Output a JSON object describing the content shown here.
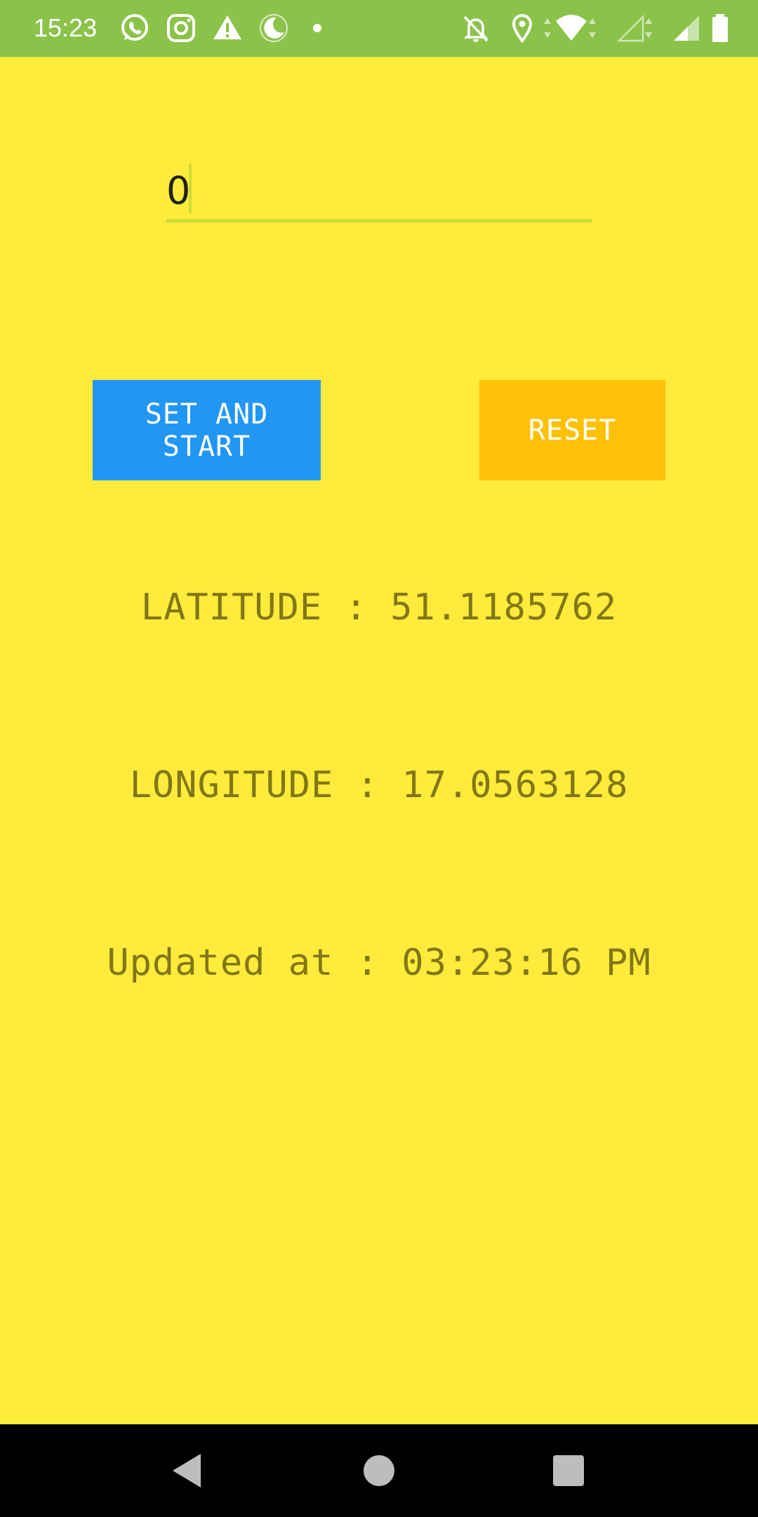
{
  "status_bar": {
    "time": "15:23",
    "background": "#8BC34A",
    "icons": [
      "whatsapp-icon",
      "instagram-icon",
      "warning-icon",
      "night-mode-icon",
      "dot-icon",
      "bell-off-icon",
      "location-icon",
      "wifi-icon",
      "signal-empty-icon",
      "signal-icon",
      "battery-icon"
    ]
  },
  "app": {
    "background": "#FFEB3B",
    "input": {
      "value": "0",
      "underline_color": "#CDDC39"
    },
    "buttons": {
      "start_label": "SET AND START",
      "start_color": "#2196F3",
      "reset_label": "RESET",
      "reset_color": "#FFC107"
    },
    "latitude": "LATITUDE : 51.1185762",
    "longitude": "LONGITUDE : 17.0563128",
    "updated": "Updated at : 03:23:16 PM",
    "text_color": "#827717"
  },
  "nav_bar": {
    "icons": [
      "back-icon",
      "home-icon",
      "recents-icon"
    ]
  }
}
